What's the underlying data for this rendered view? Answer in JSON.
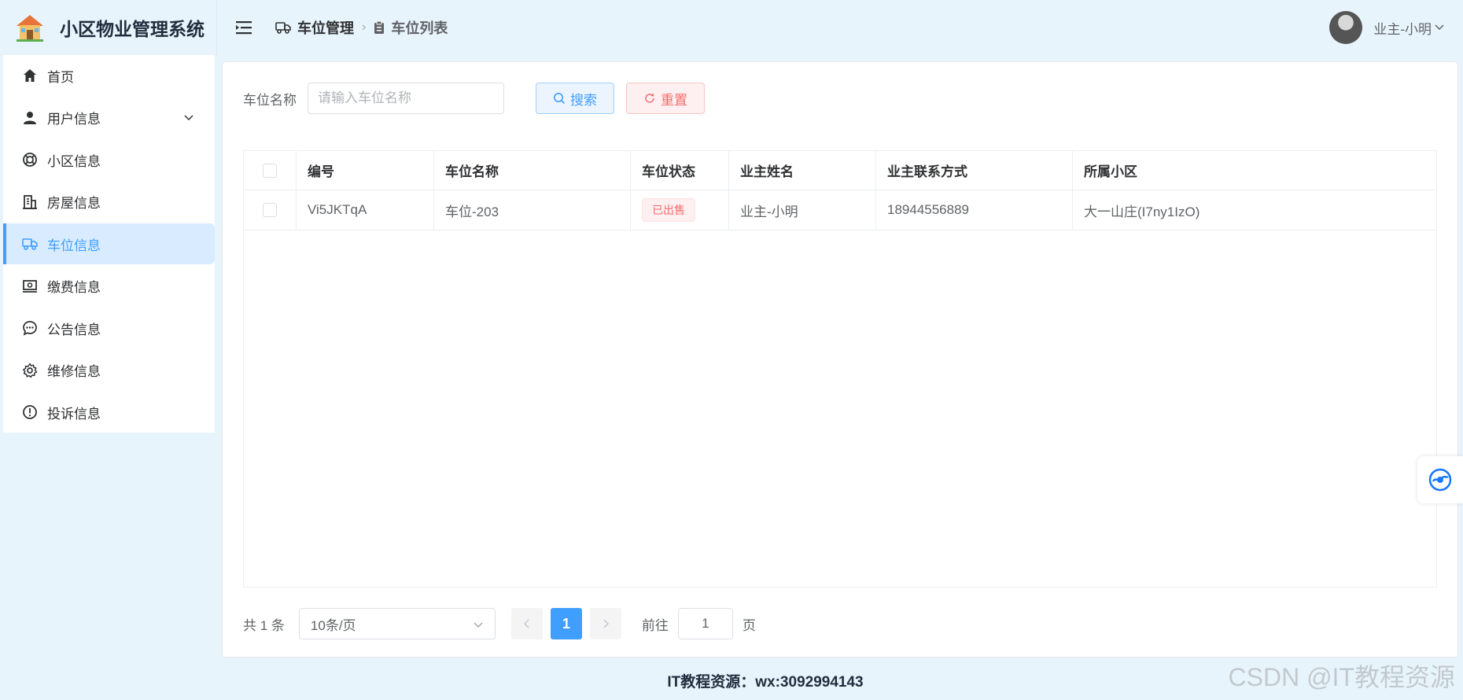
{
  "header": {
    "app_title": "小区物业管理系统",
    "breadcrumb": [
      "车位管理",
      "车位列表"
    ],
    "user_name": "业主-小明"
  },
  "sidebar": {
    "items": [
      {
        "label": "首页",
        "icon": "home-icon"
      },
      {
        "label": "用户信息",
        "icon": "user-icon",
        "expandable": true
      },
      {
        "label": "小区信息",
        "icon": "lifebuoy-icon"
      },
      {
        "label": "房屋信息",
        "icon": "building-icon"
      },
      {
        "label": "车位信息",
        "icon": "truck-icon",
        "active": true
      },
      {
        "label": "缴费信息",
        "icon": "money-icon"
      },
      {
        "label": "公告信息",
        "icon": "chat-icon"
      },
      {
        "label": "维修信息",
        "icon": "gear-icon"
      },
      {
        "label": "投诉信息",
        "icon": "warning-icon"
      }
    ]
  },
  "search": {
    "label": "车位名称",
    "placeholder": "请输入车位名称",
    "value": "",
    "search_label": "搜索",
    "reset_label": "重置"
  },
  "table": {
    "columns": [
      "编号",
      "车位名称",
      "车位状态",
      "业主姓名",
      "业主联系方式",
      "所属小区"
    ],
    "rows": [
      {
        "id": "Vi5JKTqA",
        "name": "车位-203",
        "status": "已出售",
        "owner": "业主-小明",
        "phone": "18944556889",
        "community": "大一山庄(I7ny1IzO)"
      }
    ]
  },
  "pagination": {
    "total_text": "共 1 条",
    "page_size": "10条/页",
    "current_page": "1",
    "goto_prefix": "前往",
    "goto_value": "1",
    "goto_suffix": "页"
  },
  "footer": {
    "text": "IT教程资源：wx:3092994143",
    "watermark": "CSDN @IT教程资源"
  },
  "colors": {
    "primary": "#409eff",
    "danger": "#f56c6c",
    "background": "#e8f4fc"
  }
}
